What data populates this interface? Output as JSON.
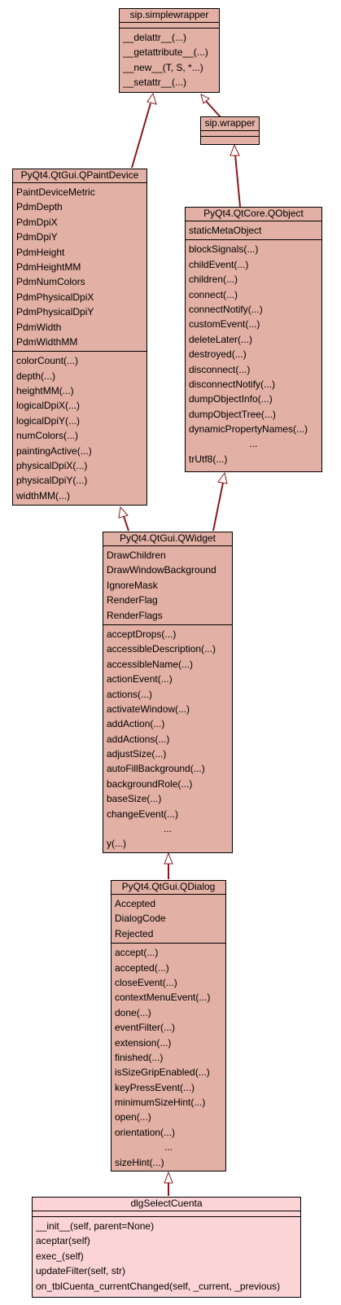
{
  "classes": {
    "simplewrapper": {
      "name": "sip.simplewrapper",
      "attributes": [],
      "methods": [
        "__delattr__(...)",
        "__getattribute__(...)",
        "__new__(T, S, *...)",
        "__setattr__(...)"
      ]
    },
    "wrapper": {
      "name": "sip.wrapper",
      "attributes": [],
      "methods": []
    },
    "qpaintdevice": {
      "name": "PyQt4.QtGui.QPaintDevice",
      "attributes": [
        "PaintDeviceMetric",
        "PdmDepth",
        "PdmDpiX",
        "PdmDpiY",
        "PdmHeight",
        "PdmHeightMM",
        "PdmNumColors",
        "PdmPhysicalDpiX",
        "PdmPhysicalDpiY",
        "PdmWidth",
        "PdmWidthMM"
      ],
      "methods": [
        "colorCount(...)",
        "depth(...)",
        "heightMM(...)",
        "logicalDpiX(...)",
        "logicalDpiY(...)",
        "numColors(...)",
        "paintingActive(...)",
        "physicalDpiX(...)",
        "physicalDpiY(...)",
        "widthMM(...)"
      ]
    },
    "qobject": {
      "name": "PyQt4.QtCore.QObject",
      "attributes": [
        "staticMetaObject"
      ],
      "methods": [
        "blockSignals(...)",
        "childEvent(...)",
        "children(...)",
        "connect(...)",
        "connectNotify(...)",
        "customEvent(...)",
        "deleteLater(...)",
        "destroyed(...)",
        "disconnect(...)",
        "disconnectNotify(...)",
        "dumpObjectInfo(...)",
        "dumpObjectTree(...)",
        "dynamicPropertyNames(...)",
        "...",
        "trUtf8(...)"
      ]
    },
    "qwidget": {
      "name": "PyQt4.QtGui.QWidget",
      "attributes": [
        "DrawChildren",
        "DrawWindowBackground",
        "IgnoreMask",
        "RenderFlag",
        "RenderFlags"
      ],
      "methods": [
        "acceptDrops(...)",
        "accessibleDescription(...)",
        "accessibleName(...)",
        "actionEvent(...)",
        "actions(...)",
        "activateWindow(...)",
        "addAction(...)",
        "addActions(...)",
        "adjustSize(...)",
        "autoFillBackground(...)",
        "backgroundRole(...)",
        "baseSize(...)",
        "changeEvent(...)",
        "...",
        "y(...)"
      ]
    },
    "qdialog": {
      "name": "PyQt4.QtGui.QDialog",
      "attributes": [
        "Accepted",
        "DialogCode",
        "Rejected"
      ],
      "methods": [
        "accept(...)",
        "accepted(...)",
        "closeEvent(...)",
        "contextMenuEvent(...)",
        "done(...)",
        "eventFilter(...)",
        "extension(...)",
        "finished(...)",
        "isSizeGripEnabled(...)",
        "keyPressEvent(...)",
        "minimumSizeHint(...)",
        "open(...)",
        "orientation(...)",
        "...",
        "sizeHint(...)"
      ]
    },
    "dlgselectcuenta": {
      "name": "dlgSelectCuenta",
      "attributes": [],
      "methods": [
        "__init__(self, parent=None)",
        "aceptar(self)",
        "exec_(self)",
        "updateFilter(self, str)",
        "on_tblCuenta_currentChanged(self, _current, _previous)"
      ]
    }
  },
  "edges": [
    {
      "from": "wrapper",
      "to": "simplewrapper"
    },
    {
      "from": "qpaintdevice",
      "to": "simplewrapper"
    },
    {
      "from": "qobject",
      "to": "wrapper"
    },
    {
      "from": "qwidget",
      "to": "qpaintdevice"
    },
    {
      "from": "qwidget",
      "to": "qobject"
    },
    {
      "from": "qdialog",
      "to": "qwidget"
    },
    {
      "from": "dlgselectcuenta",
      "to": "qdialog"
    }
  ],
  "colors": {
    "class_fill": "#e2b0a4",
    "leaf_fill": "#fdd4d6",
    "edge": "#8b1a1a",
    "border": "#000000"
  }
}
